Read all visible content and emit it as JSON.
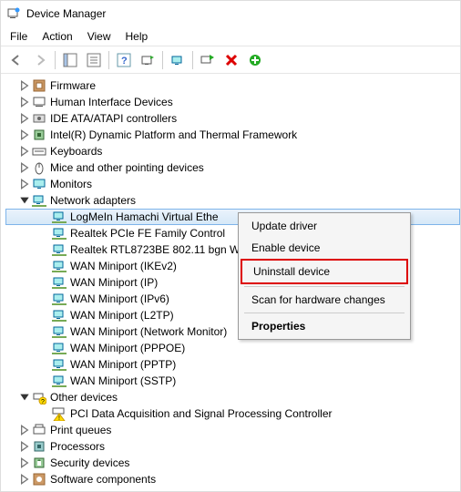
{
  "window": {
    "title": "Device Manager"
  },
  "menubar": [
    "File",
    "Action",
    "View",
    "Help"
  ],
  "toolbar": {
    "back": "back-icon",
    "forward": "forward-icon",
    "options": "options-icon",
    "devices": "devices-icon",
    "help": "help-icon",
    "usb": "usb-icon",
    "monitor": "monitor-icon",
    "scan": "scan-icon",
    "delete": "delete-icon",
    "enable": "enable-icon"
  },
  "tree": [
    {
      "depth": 0,
      "toggle": ">",
      "icon": "firmware",
      "label": "Firmware"
    },
    {
      "depth": 0,
      "toggle": ">",
      "icon": "hid",
      "label": "Human Interface Devices"
    },
    {
      "depth": 0,
      "toggle": ">",
      "icon": "ide",
      "label": "IDE ATA/ATAPI controllers"
    },
    {
      "depth": 0,
      "toggle": ">",
      "icon": "chip",
      "label": "Intel(R) Dynamic Platform and Thermal Framework"
    },
    {
      "depth": 0,
      "toggle": ">",
      "icon": "keyboard",
      "label": "Keyboards"
    },
    {
      "depth": 0,
      "toggle": ">",
      "icon": "mouse",
      "label": "Mice and other pointing devices"
    },
    {
      "depth": 0,
      "toggle": ">",
      "icon": "monitor",
      "label": "Monitors"
    },
    {
      "depth": 0,
      "toggle": "v",
      "icon": "network",
      "label": "Network adapters"
    },
    {
      "depth": 1,
      "toggle": "",
      "icon": "network",
      "label": "LogMeIn Hamachi Virtual Ethe",
      "selected": true
    },
    {
      "depth": 1,
      "toggle": "",
      "icon": "network",
      "label": "Realtek PCIe FE Family Control"
    },
    {
      "depth": 1,
      "toggle": "",
      "icon": "network",
      "label": "Realtek RTL8723BE 802.11 bgn W"
    },
    {
      "depth": 1,
      "toggle": "",
      "icon": "network",
      "label": "WAN Miniport (IKEv2)"
    },
    {
      "depth": 1,
      "toggle": "",
      "icon": "network",
      "label": "WAN Miniport (IP)"
    },
    {
      "depth": 1,
      "toggle": "",
      "icon": "network",
      "label": "WAN Miniport (IPv6)"
    },
    {
      "depth": 1,
      "toggle": "",
      "icon": "network",
      "label": "WAN Miniport (L2TP)"
    },
    {
      "depth": 1,
      "toggle": "",
      "icon": "network",
      "label": "WAN Miniport (Network Monitor)"
    },
    {
      "depth": 1,
      "toggle": "",
      "icon": "network",
      "label": "WAN Miniport (PPPOE)"
    },
    {
      "depth": 1,
      "toggle": "",
      "icon": "network",
      "label": "WAN Miniport (PPTP)"
    },
    {
      "depth": 1,
      "toggle": "",
      "icon": "network",
      "label": "WAN Miniport (SSTP)"
    },
    {
      "depth": 0,
      "toggle": "v",
      "icon": "other",
      "label": "Other devices"
    },
    {
      "depth": 1,
      "toggle": "",
      "icon": "warn",
      "label": "PCI Data Acquisition and Signal Processing Controller"
    },
    {
      "depth": 0,
      "toggle": ">",
      "icon": "queue",
      "label": "Print queues"
    },
    {
      "depth": 0,
      "toggle": ">",
      "icon": "cpu",
      "label": "Processors"
    },
    {
      "depth": 0,
      "toggle": ">",
      "icon": "security",
      "label": "Security devices"
    },
    {
      "depth": 0,
      "toggle": ">",
      "icon": "software",
      "label": "Software components"
    }
  ],
  "context_menu": [
    {
      "label": "Update driver",
      "type": "item"
    },
    {
      "label": "Enable device",
      "type": "item"
    },
    {
      "label": "Uninstall device",
      "type": "item",
      "highlight": true
    },
    {
      "type": "sep"
    },
    {
      "label": "Scan for hardware changes",
      "type": "item"
    },
    {
      "type": "sep"
    },
    {
      "label": "Properties",
      "type": "item",
      "bold": true
    }
  ]
}
